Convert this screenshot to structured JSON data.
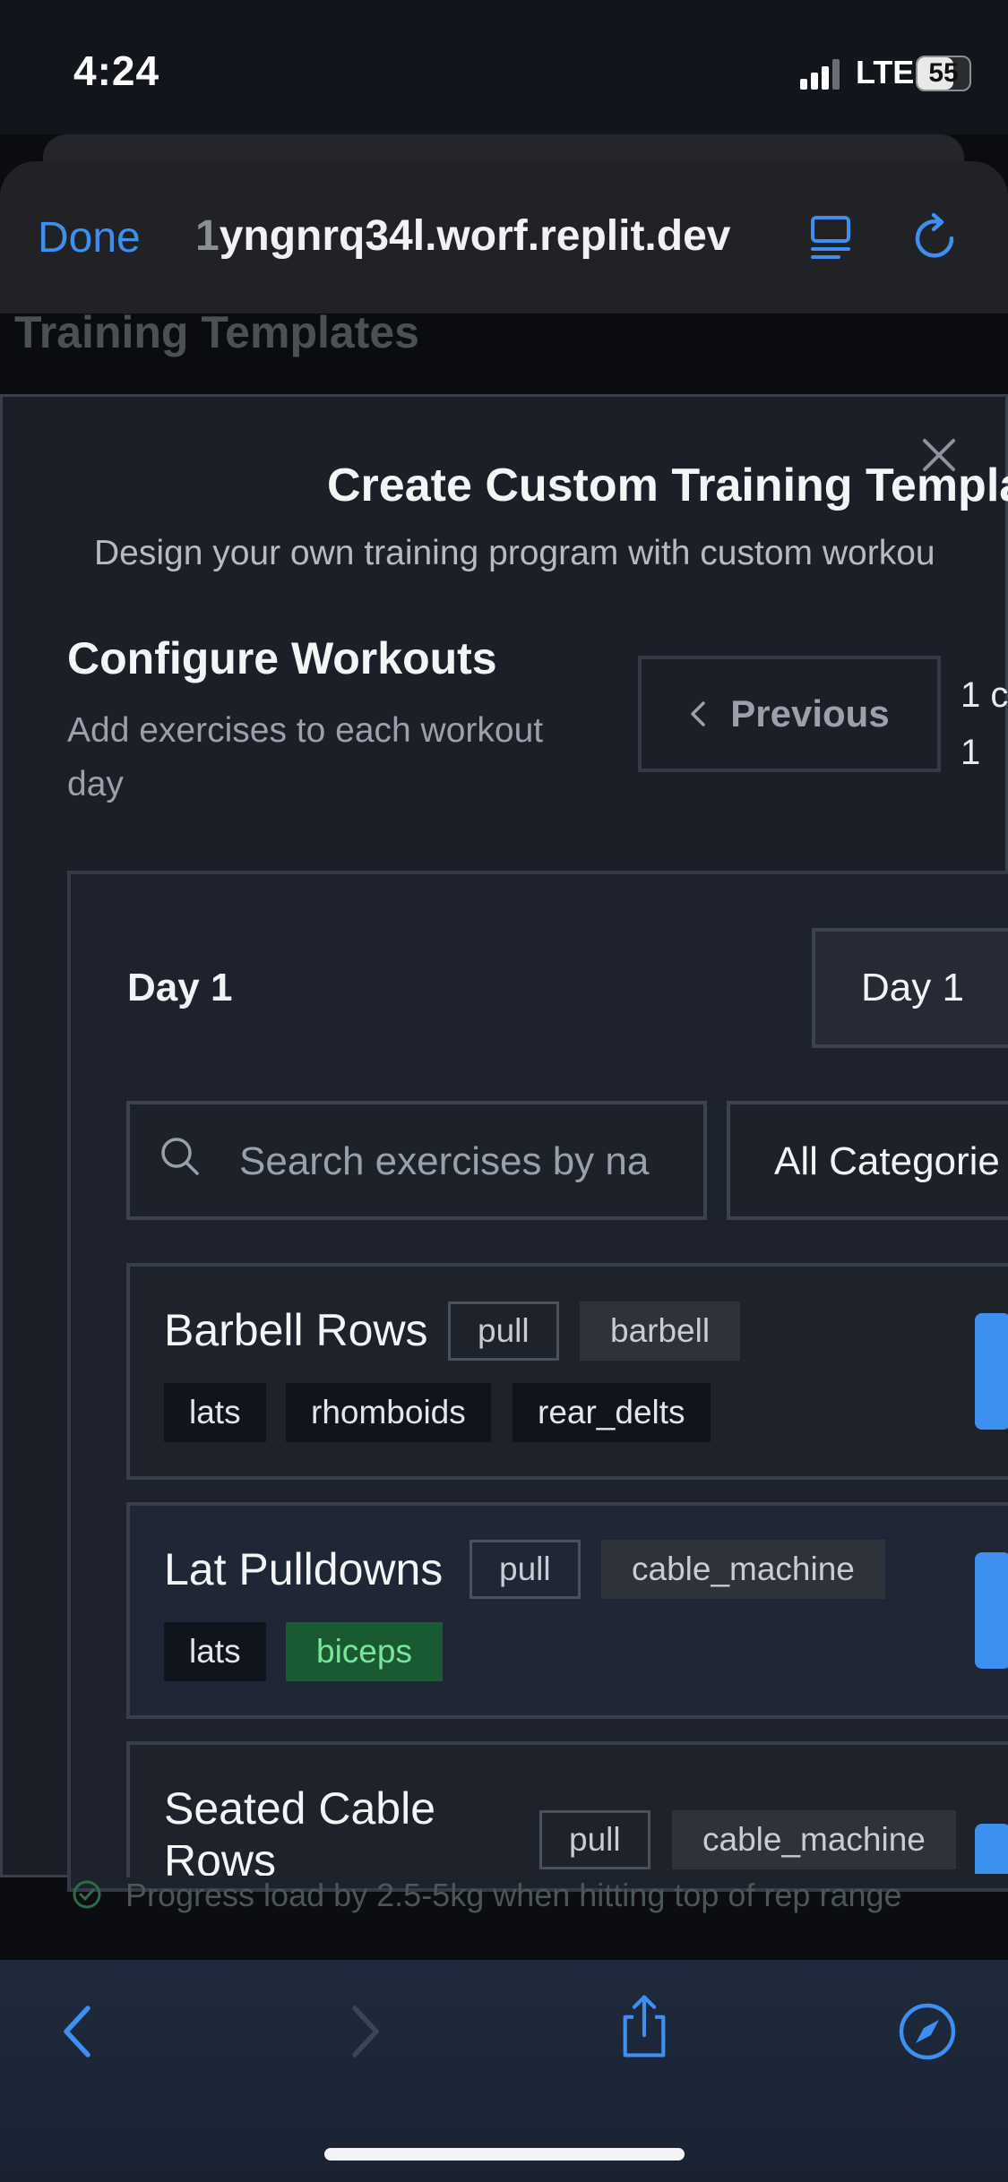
{
  "status_bar": {
    "time": "4:24",
    "network": "LTE",
    "battery": "55"
  },
  "browser": {
    "done_label": "Done",
    "url_first_char": "1",
    "url_rest": "yngnrq34l.worf.replit.dev"
  },
  "background_page": {
    "title": "Training Templates",
    "tip": "Progress load by 2.5-5kg when hitting top of rep range"
  },
  "modal": {
    "title": "Create Custom Training Templat",
    "subtitle": "Design your own training program with custom workou",
    "configure_title": "Configure Workouts",
    "configure_subtitle": "Add exercises to each workout day",
    "previous_label": "Previous",
    "page_indicator": "1 c\n1",
    "day_label": "Day 1",
    "day_select_value": "Day 1",
    "search_placeholder": "Search exercises by na",
    "category_value": "All Categorie"
  },
  "exercises": [
    {
      "name": "Barbell Rows",
      "category": "pull",
      "equipment": "barbell",
      "muscles": [
        "lats",
        "rhomboids",
        "rear_delts"
      ]
    },
    {
      "name": "Lat Pulldowns",
      "category": "pull",
      "equipment": "cable_machine",
      "muscles": [
        "lats",
        "biceps"
      ]
    },
    {
      "name_line1": "Seated Cable",
      "name_line2": "Rows",
      "category": "pull",
      "equipment": "cable_machine"
    }
  ],
  "colors": {
    "accent": "#3d8ff0",
    "modal_bg": "#1c1f27",
    "green_tag_bg": "#1a5a33",
    "green_tag_text": "#7be39c"
  },
  "icons": [
    "signal-icon",
    "battery-icon",
    "reader-icon",
    "reload-icon",
    "close-icon",
    "chevron-left-icon",
    "search-icon",
    "back-icon",
    "forward-icon",
    "share-icon",
    "compass-icon",
    "check-circle-icon"
  ]
}
